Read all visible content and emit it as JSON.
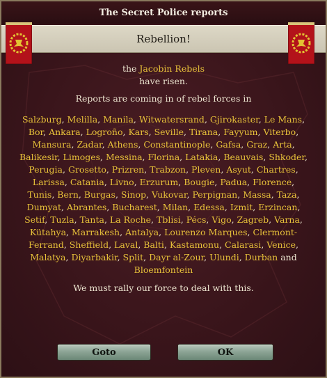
{
  "window": {
    "title": "The Secret Police reports",
    "header": "Rebellion!"
  },
  "message": {
    "prefix": "the",
    "rebels": "Jacobin Rebels",
    "risen": "have risen.",
    "reports": "Reports are coming in of rebel forces in",
    "cities": [
      "Salzburg",
      "Melilla",
      "Manila",
      "Witwatersrand",
      "Gjirokaster",
      "Le Mans",
      "Bor",
      "Ankara",
      "Logroño",
      "Kars",
      "Seville",
      "Tirana",
      "Fayyum",
      "Viterbo",
      "Mansura",
      "Zadar",
      "Athens",
      "Constantinople",
      "Gafsa",
      "Graz",
      "Arta",
      "Balikesir",
      "Limoges",
      "Messina",
      "Florina",
      "Latakia",
      "Beauvais",
      "Shkoder",
      "Perugia",
      "Grosetto",
      "Prizren",
      "Trabzon",
      "Pleven",
      "Asyut",
      "Chartres",
      "Larissa",
      "Catania",
      "Livno",
      "Erzurum",
      "Bougie",
      "Padua",
      "Florence",
      "Tunis",
      "Bern",
      "Burgas",
      "Sinop",
      "Vukovar",
      "Perpignan",
      "Massa",
      "Taza",
      "Dumyat",
      "Abrantes",
      "Bucharest",
      "Milan",
      "Edessa",
      "Izmit",
      "Erzincan",
      "Setif",
      "Tuzla",
      "Tanta",
      "La Roche",
      "Tblisi",
      "Pécs",
      "Vigo",
      "Zagreb",
      "Varna",
      "Kütahya",
      "Marrakesh",
      "Antalya",
      "Lourenzo Marques",
      "Clermont-Ferrand",
      "Sheffield",
      "Laval",
      "Balti",
      "Kastamonu",
      "Calarasi",
      "Venice",
      "Malatya",
      "Diyarbakir",
      "Split",
      "Dayr al-Zour",
      "Ulundi",
      "Durban"
    ],
    "and": "and",
    "last_city": "Bloemfontein",
    "rally": "We must rally our force to deal with this."
  },
  "buttons": {
    "goto": "Goto",
    "ok": "OK"
  },
  "colors": {
    "city_gold": "#e8c23a",
    "background": "#3a151b",
    "banner_red": "#b3121a"
  },
  "icons": {
    "left_banner": "laurel-eagle-banner-icon",
    "right_banner": "laurel-eagle-banner-icon"
  }
}
